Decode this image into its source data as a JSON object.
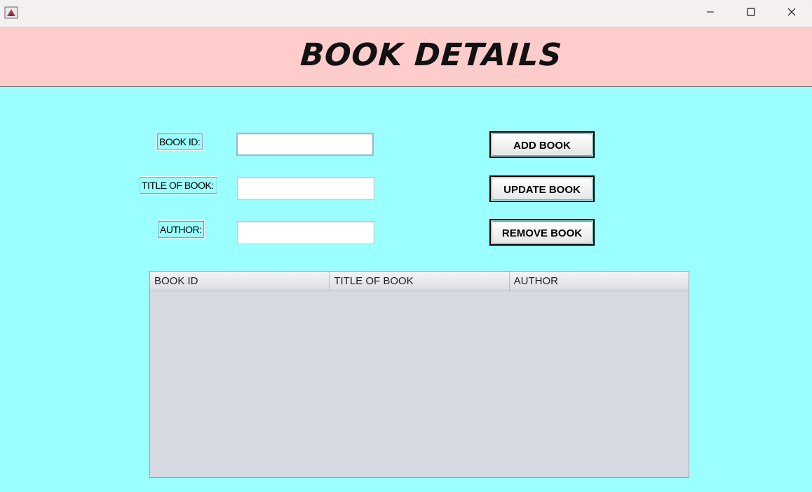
{
  "window": {
    "icons": {
      "app": "java-app-icon",
      "minimize": "minimize-icon",
      "maximize": "maximize-icon",
      "close": "close-icon"
    }
  },
  "header": {
    "title": "BOOK DETAILS"
  },
  "form": {
    "book_id_label": "BOOK ID:",
    "title_label": "TITLE OF BOOK:",
    "author_label": "AUTHOR:",
    "book_id_value": "",
    "title_value": "",
    "author_value": ""
  },
  "actions": {
    "add_label": "ADD BOOK",
    "update_label": "UPDATE BOOK",
    "remove_label": "REMOVE BOOK"
  },
  "table": {
    "columns": [
      "BOOK ID",
      "TITLE OF BOOK",
      "AUTHOR"
    ],
    "rows": []
  },
  "colors": {
    "background": "#9cffff",
    "banner": "#ffcccc",
    "table_body": "#d6d9e1"
  }
}
